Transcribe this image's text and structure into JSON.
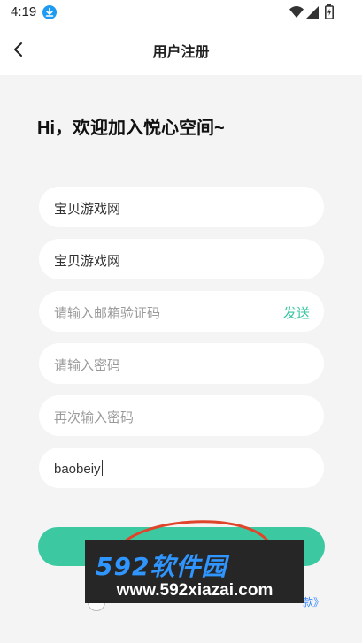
{
  "status_bar": {
    "time": "4:19",
    "icons": [
      "download-icon",
      "wifi-icon",
      "signal-icon",
      "battery-icon"
    ]
  },
  "header": {
    "back_icon": "chevron-left-icon",
    "title": "用户注册"
  },
  "greeting": "Hi，欢迎加入悦心空间~",
  "form": {
    "field1_value": "宝贝游戏网",
    "field2_value": "宝贝游戏网",
    "email_code_placeholder": "请输入邮箱验证码",
    "send_label": "发送",
    "password_placeholder": "请输入密码",
    "confirm_password_placeholder": "再次输入密码",
    "invite_value": "baobeiy"
  },
  "register_button": {
    "label": ""
  },
  "agreement": {
    "tail_text": "款》"
  },
  "watermark": {
    "brand": "592软件园",
    "site": "www.592xiazai.com"
  },
  "colors": {
    "accent": "#3cc9a1",
    "link": "#35c59f",
    "background": "#f4f4f4",
    "annotation": "#e0442a",
    "watermark_bg": "#262626",
    "watermark_brand": "#2f95ff"
  }
}
